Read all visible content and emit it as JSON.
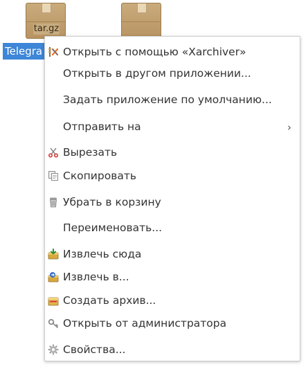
{
  "desktop": {
    "icons": [
      {
        "badge": "tar.gz",
        "icon": "package-archive-icon"
      },
      {
        "badge": "",
        "icon": "package-archive-icon"
      }
    ],
    "selected_file_label": "Telegra"
  },
  "context_menu": {
    "items": [
      {
        "label": "Открыть с помощью «Xarchiver»",
        "icon": "xarchiver-icon"
      },
      {
        "label": "Открыть в другом приложении...",
        "icon": ""
      },
      {
        "label": "Задать приложение по умолчанию...",
        "icon": ""
      },
      {
        "label": "Отправить на",
        "icon": "",
        "submenu_arrow": "›"
      },
      {
        "label": "Вырезать",
        "icon": "scissors-icon"
      },
      {
        "label": "Скопировать",
        "icon": "copy-icon"
      },
      {
        "label": "Убрать в корзину",
        "icon": "trash-icon"
      },
      {
        "label": "Переименовать...",
        "icon": ""
      },
      {
        "label": "Извлечь сюда",
        "icon": "extract-here-icon"
      },
      {
        "label": "Извлечь в...",
        "icon": "extract-to-icon"
      },
      {
        "label": "Создать архив...",
        "icon": "create-archive-icon"
      },
      {
        "label": "Открыть от администратора",
        "icon": "key-icon"
      },
      {
        "label": "Свойства...",
        "icon": "gear-icon"
      }
    ]
  },
  "colors": {
    "selection_bg": "#3d86d8",
    "menu_text": "#333333",
    "menu_border": "#cfcfcf"
  }
}
